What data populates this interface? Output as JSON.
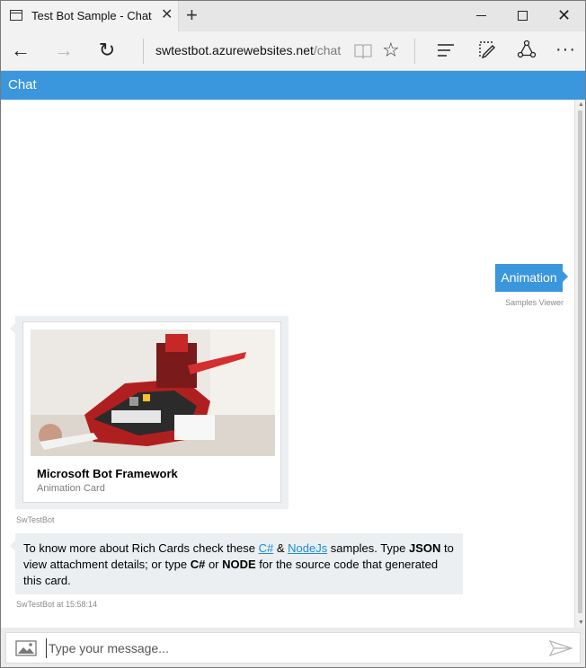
{
  "browser": {
    "tab_title": "Test Bot Sample - Chat",
    "tab_close": "✕",
    "new_tab": "+",
    "url_host": "swtestbot.azurewebsites.net",
    "url_path": "/chat",
    "more": "···",
    "window_controls": {
      "close": "✕"
    }
  },
  "icons": {
    "tab": "tab-icon",
    "back": "arrow-left-icon",
    "forward": "arrow-right-icon",
    "refresh": "refresh-icon",
    "reading_view": "book-icon",
    "favorite": "star-icon",
    "hub": "hub-icon",
    "web_note": "pen-icon",
    "share": "share-icon",
    "upload": "image-icon",
    "send": "send-icon"
  },
  "nav": {
    "back": "←",
    "forward": "→",
    "refresh": "↻",
    "favorite": "☆"
  },
  "chat": {
    "header_title": "Chat",
    "accent_color": "#3a96dd",
    "user_message": {
      "text": "Animation",
      "sender": "Samples Viewer"
    },
    "card": {
      "title": "Microsoft Bot Framework",
      "subtitle": "Animation Card",
      "sender": "SwTestBot"
    },
    "bot_message": {
      "part1": "To know more about Rich Cards check these ",
      "link_csharp": "C#",
      "amp": " & ",
      "link_node": "NodeJs",
      "part2": " samples. Type ",
      "json": "JSON",
      "part3": " to view attachment details; or type ",
      "csharp": "C#",
      "or": " or ",
      "node": "NODE",
      "part4": " for the source code that generated this card.",
      "meta": "SwTestBot at 15:58:14"
    },
    "input": {
      "placeholder": "Type your message..."
    }
  }
}
